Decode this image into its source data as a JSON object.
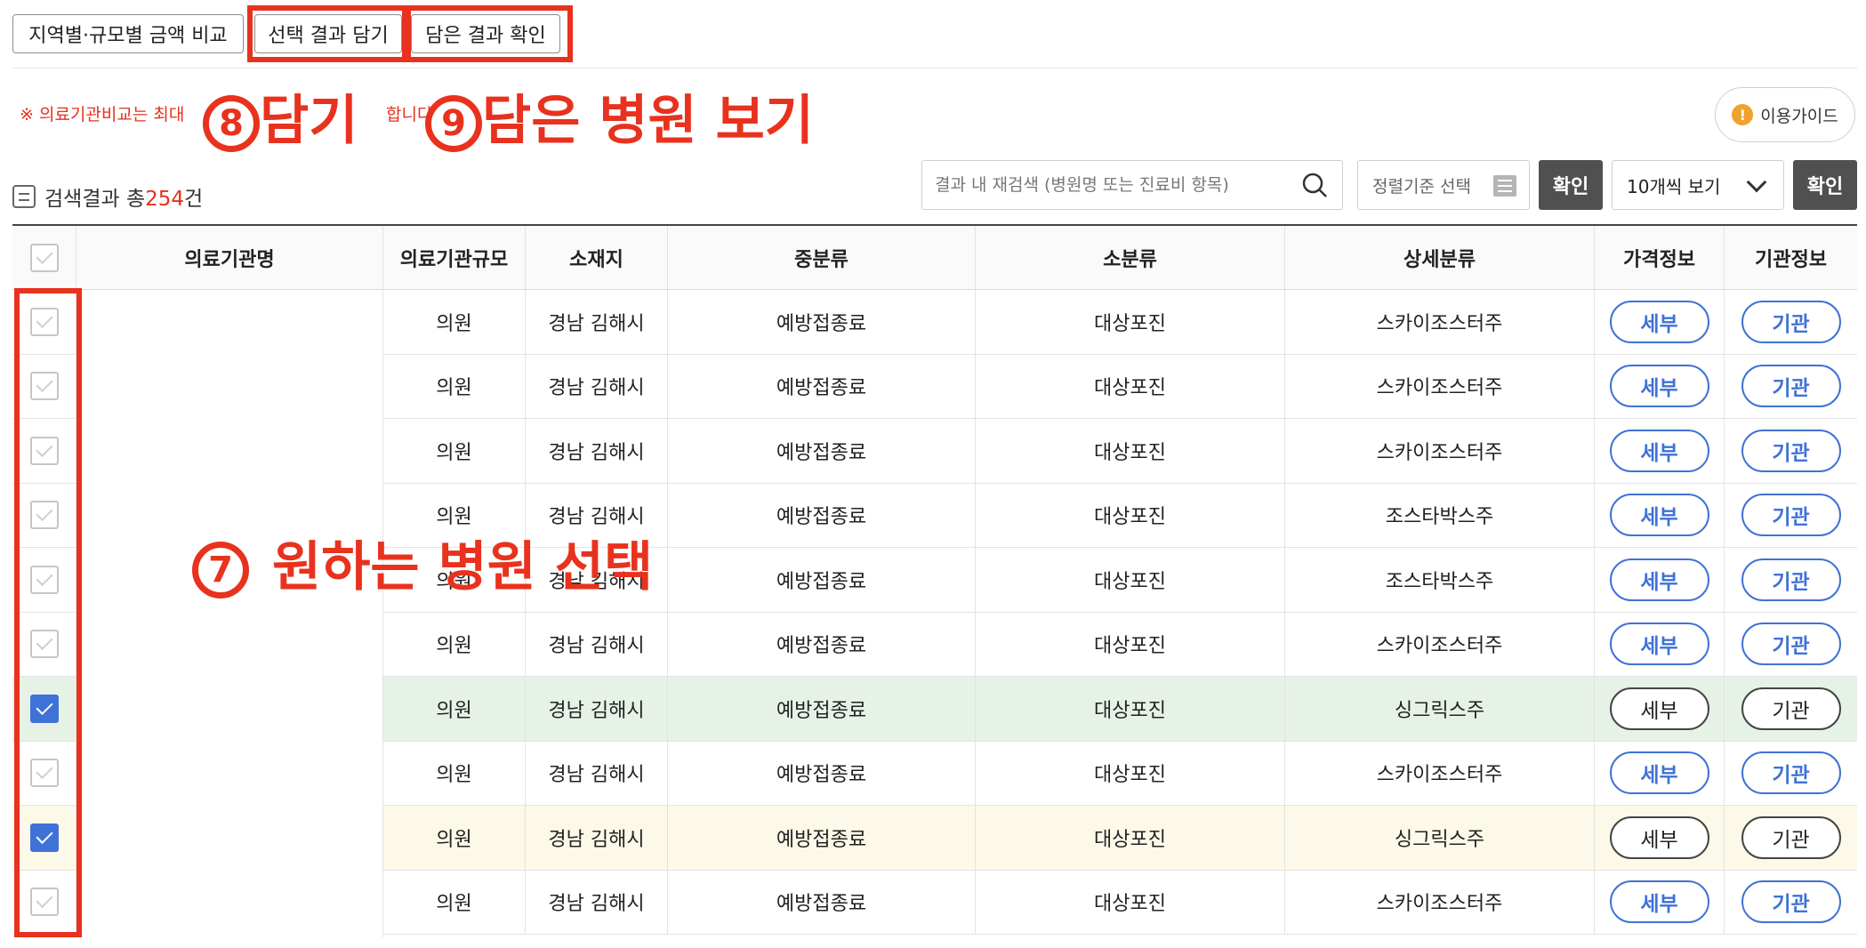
{
  "top_buttons": {
    "compare": "지역별·규모별 금액 비교",
    "add_selected": "선택 결과 담기",
    "view_added": "담은 결과 확인"
  },
  "notice": {
    "text_left": "※ 의료기관비교는 최대",
    "text_right": "합니다"
  },
  "annotations": {
    "step8_num": "8",
    "step8_text": "담기",
    "step9_num": "9",
    "step9_text": "담은 병원 보기",
    "step7_num": "7",
    "step7_text": "원하는 병원 선택",
    "color": "#e8321e"
  },
  "guide_button": {
    "label": "이용가이드",
    "icon": "!"
  },
  "result": {
    "prefix": "검색결과 총",
    "count": "254",
    "suffix": "건"
  },
  "search": {
    "placeholder": "결과 내 재검색 (병원명 또는 진료비 항목)"
  },
  "sort": {
    "label": "정렬기준 선택"
  },
  "confirm_label": "확인",
  "page_size": {
    "selected": "10개씩 보기"
  },
  "table": {
    "headers": [
      "",
      "의료기관명",
      "의료기관규모",
      "소재지",
      "중분류",
      "소분류",
      "상세분류",
      "가격정보",
      "기관정보"
    ],
    "rows": [
      {
        "checked": false,
        "size": "의원",
        "loc": "경남 김해시",
        "mid": "예방접종료",
        "small": "대상포진",
        "detail": "스카이조스터주",
        "price": "세부",
        "org": "기관",
        "style": "normal"
      },
      {
        "checked": false,
        "size": "의원",
        "loc": "경남 김해시",
        "mid": "예방접종료",
        "small": "대상포진",
        "detail": "스카이조스터주",
        "price": "세부",
        "org": "기관",
        "style": "normal"
      },
      {
        "checked": false,
        "size": "의원",
        "loc": "경남 김해시",
        "mid": "예방접종료",
        "small": "대상포진",
        "detail": "스카이조스터주",
        "price": "세부",
        "org": "기관",
        "style": "normal"
      },
      {
        "checked": false,
        "size": "의원",
        "loc": "경남 김해시",
        "mid": "예방접종료",
        "small": "대상포진",
        "detail": "조스타박스주",
        "price": "세부",
        "org": "기관",
        "style": "normal"
      },
      {
        "checked": false,
        "size": "의원",
        "loc": "경남 김해시",
        "mid": "예방접종료",
        "small": "대상포진",
        "detail": "조스타박스주",
        "price": "세부",
        "org": "기관",
        "style": "normal"
      },
      {
        "checked": false,
        "size": "의원",
        "loc": "경남 김해시",
        "mid": "예방접종료",
        "small": "대상포진",
        "detail": "스카이조스터주",
        "price": "세부",
        "org": "기관",
        "style": "normal"
      },
      {
        "checked": true,
        "size": "의원",
        "loc": "경남 김해시",
        "mid": "예방접종료",
        "small": "대상포진",
        "detail": "싱그릭스주",
        "price": "세부",
        "org": "기관",
        "style": "green"
      },
      {
        "checked": false,
        "size": "의원",
        "loc": "경남 김해시",
        "mid": "예방접종료",
        "small": "대상포진",
        "detail": "스카이조스터주",
        "price": "세부",
        "org": "기관",
        "style": "normal"
      },
      {
        "checked": true,
        "size": "의원",
        "loc": "경남 김해시",
        "mid": "예방접종료",
        "small": "대상포진",
        "detail": "싱그릭스주",
        "price": "세부",
        "org": "기관",
        "style": "yellow"
      },
      {
        "checked": false,
        "size": "의원",
        "loc": "경남 김해시",
        "mid": "예방접종료",
        "small": "대상포진",
        "detail": "스카이조스터주",
        "price": "세부",
        "org": "기관",
        "style": "normal"
      }
    ]
  }
}
